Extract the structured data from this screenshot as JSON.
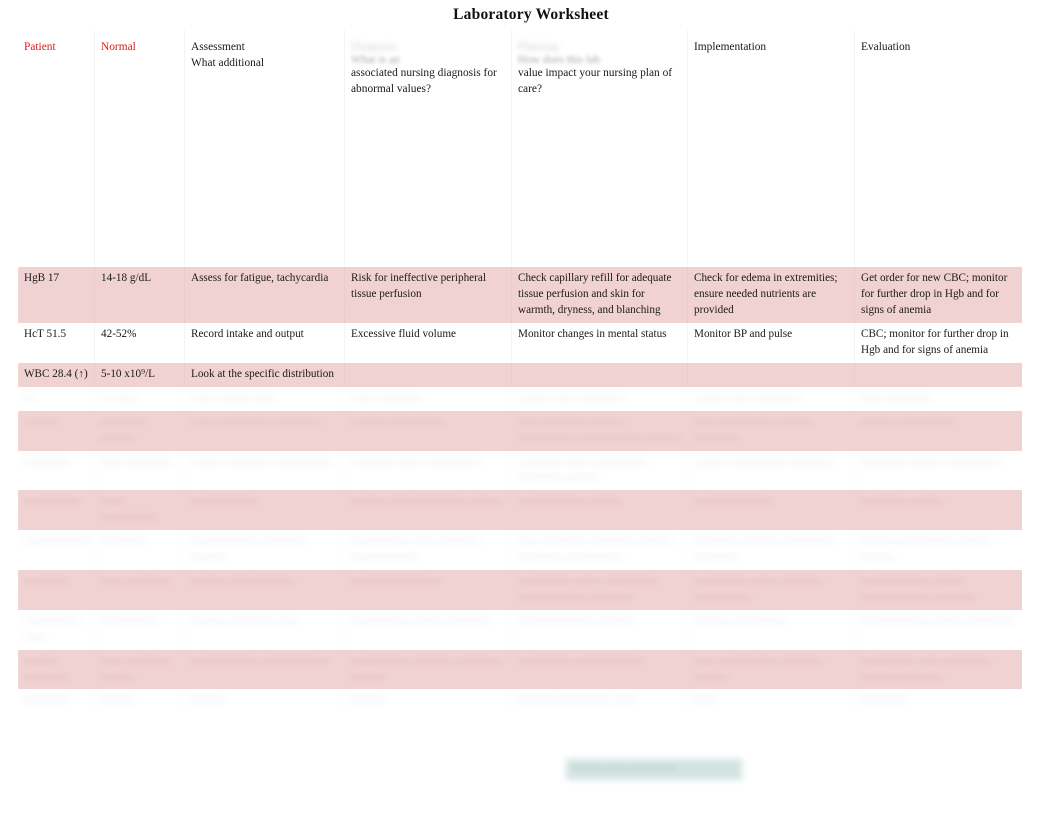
{
  "document": {
    "title": "Laboratory Worksheet"
  },
  "colors": {
    "header_accent": "#e01b1b",
    "row_highlight": "#f1d2d2",
    "row_highlight_alt": "#f3d8d8",
    "teal_highlight": "#cfe0df",
    "text": "#1a1a1a",
    "page_background": "#ffffff"
  },
  "table": {
    "columns": [
      {
        "key": "patient",
        "label": "Patient",
        "color": "#e01b1b",
        "prompt": ""
      },
      {
        "key": "normal",
        "label": "Normal",
        "color": "#e01b1b",
        "prompt": ""
      },
      {
        "key": "assessment",
        "label": "Assessment",
        "color": "#1a1a1a",
        "prompt": "What additional"
      },
      {
        "key": "diagnosis",
        "label": "Diagnosis",
        "color": "#1a1a1a",
        "prompt_clipped": "What is an",
        "prompt": "associated nursing diagnosis for abnormal values?"
      },
      {
        "key": "planning",
        "label": "Planning",
        "color": "#1a1a1a",
        "prompt_clipped": "How does this lab",
        "prompt": "value impact your nursing plan of care?"
      },
      {
        "key": "implementation",
        "label": "Implementation",
        "color": "#1a1a1a",
        "prompt": ""
      },
      {
        "key": "evaluation",
        "label": "Evaluation",
        "color": "#1a1a1a",
        "prompt": ""
      }
    ],
    "rows": [
      {
        "legible": true,
        "style": "pink",
        "patient": "HgB 17",
        "normal": "14-18 g/dL",
        "assessment": "Assess for fatigue, tachycardia",
        "diagnosis": "Risk for ineffective peripheral tissue perfusion",
        "planning": "Check capillary refill for adequate tissue perfusion and skin for warmth, dryness, and blanching",
        "implementation": "Check for edema in extremities; ensure needed nutrients are provided",
        "evaluation": "Get order for new CBC; monitor for further drop in Hgb and for signs of anemia"
      },
      {
        "legible": true,
        "style": "plain",
        "patient": "HcT 51.5",
        "normal": "42-52%",
        "assessment": "Record intake and output",
        "diagnosis": "Excessive fluid volume",
        "planning": "Monitor changes in mental status",
        "implementation": "Monitor BP and pulse",
        "evaluation": "CBC; monitor for further drop in Hgb and for signs of anemia"
      },
      {
        "legible": true,
        "style": "pink",
        "patient": "WBC 28.4 (↑)",
        "normal": "5-10 x10⁹/L",
        "assessment": "Look at the specific distribution",
        "diagnosis": "",
        "planning": "",
        "implementation": "",
        "evaluation": ""
      },
      {
        "legible": false,
        "style": "plain",
        "patient": "—",
        "normal": "— ——",
        "assessment": "—— ——— ——",
        "diagnosis": "—— ————",
        "planning": "——— —— ————",
        "implementation": "——— —— ————",
        "evaluation": "—— ————"
      },
      {
        "legible": false,
        "style": "pink",
        "patient": "———",
        "normal": "———— ———",
        "assessment": "—— ————— ————",
        "diagnosis": "——— —————",
        "planning": "—— ———— ——— ————— —————— ———",
        "implementation": "—— ————— ——— ————",
        "evaluation": "——— —————"
      },
      {
        "legible": false,
        "style": "plain",
        "patient": "————",
        "normal": "—— ————",
        "assessment": "——— ———— —————",
        "diagnosis": "———— —— —————",
        "planning": "———— —— ————— ———— ———",
        "implementation": "——— ————— ————",
        "evaluation": "———— ——— —————"
      },
      {
        "legible": false,
        "style": "pink",
        "patient": "—————",
        "normal": "—— —————",
        "assessment": "——————",
        "diagnosis": "——— ——————— ———",
        "planning": "—————— ———",
        "implementation": "———————",
        "evaluation": "———— ———"
      },
      {
        "legible": false,
        "style": "plain",
        "patient": "——————",
        "normal": "————",
        "assessment": "—————— ———— ———",
        "diagnosis": "————— —— ———— ——————",
        "planning": "—— ———— ———— ——— ———— —————",
        "implementation": "———— ——— ————— ————",
        "evaluation": "——— ————— ——— ———"
      },
      {
        "legible": false,
        "style": "pink",
        "patient": "————",
        "normal": "—— ————",
        "assessment": "——— ——————",
        "diagnosis": "————————",
        "planning": "————— —— ————— —————— ————",
        "implementation": "————— —— ———— —————",
        "evaluation": "—————— ——— —————— ————"
      },
      {
        "legible": false,
        "style": "plain",
        "patient": "————— ——",
        "normal": "—————",
        "assessment": "——— ———— ——",
        "diagnosis": "————— ——— ————",
        "planning": "——————— ———",
        "implementation": "——— —————",
        "evaluation": "—————— ——— ————"
      },
      {
        "legible": false,
        "style": "pink",
        "patient": "——— ————",
        "normal": "—— ———— ———",
        "assessment": "—————— ——————",
        "diagnosis": "————— ———— ———— ———",
        "planning": "————— ——————",
        "implementation": "—— ————— ———— ———",
        "evaluation": "————— —— ———— ——— ————"
      },
      {
        "legible": false,
        "style": "plain",
        "patient": "————",
        "normal": "———",
        "assessment": "———",
        "diagnosis": "———",
        "planning": "——— ————— ——",
        "implementation": "——",
        "evaluation": "————"
      }
    ]
  },
  "annotation": {
    "teal_fragment": "——— —— ————"
  }
}
